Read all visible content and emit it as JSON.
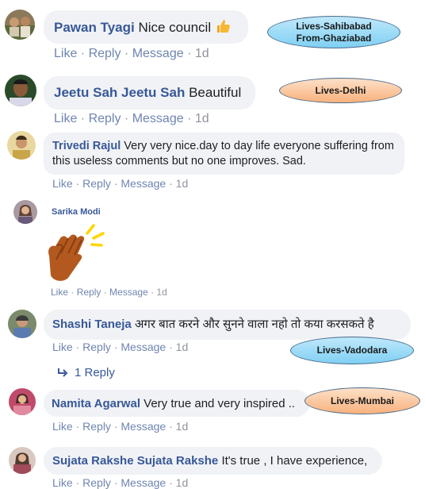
{
  "comments": [
    {
      "name": "Pawan Tyagi",
      "text": "Nice council",
      "emoji": "thumbs-up",
      "actions": {
        "like": "Like",
        "reply": "Reply",
        "message": "Message",
        "time": "1d"
      },
      "tag": {
        "line1": "Lives-Sahibabad",
        "line2": "From-Ghaziabad",
        "color": "#9fdcf7"
      }
    },
    {
      "name": "Jeetu Sah Jeetu Sah",
      "text": "Beautiful",
      "actions": {
        "like": "Like",
        "reply": "Reply",
        "message": "Message",
        "time": "1d"
      },
      "tag": {
        "line1": "Lives-Delhi",
        "color": "#fac79c"
      }
    },
    {
      "name": "Trivedi Rajul",
      "text": "Very very nice.day to day life everyone suffering from",
      "text2": "this useless comments but no one improves. Sad.",
      "actions": {
        "like": "Like",
        "reply": "Reply",
        "message": "Message",
        "time": "1d"
      }
    },
    {
      "name": "Sarika Modi",
      "sticker": "clapping-hands",
      "actions": {
        "like": "Like",
        "reply": "Reply",
        "message": "Message",
        "time": "1d"
      }
    },
    {
      "name": "Shashi Taneja",
      "text": "अगर बात करने और सुनने वाला नहो तो कया करसकते है",
      "actions": {
        "like": "Like",
        "reply": "Reply",
        "message": "Message",
        "time": "1d"
      },
      "replies": "1 Reply",
      "tag": {
        "line1": "Lives-Vadodara",
        "color": "#9fdcf7"
      }
    },
    {
      "name": "Namita Agarwal",
      "text": "Very true and very inspired ..",
      "actions": {
        "like": "Like",
        "reply": "Reply",
        "message": "Message",
        "time": "1d"
      },
      "tag": {
        "line1": "Lives-Mumbai",
        "color": "#fac79c"
      }
    },
    {
      "name": "Sujata Rakshe Sujata Rakshe",
      "text": "It's true , I have experience,",
      "actions": {
        "like": "Like",
        "reply": "Reply",
        "message": "Message",
        "time": "1d"
      }
    }
  ]
}
